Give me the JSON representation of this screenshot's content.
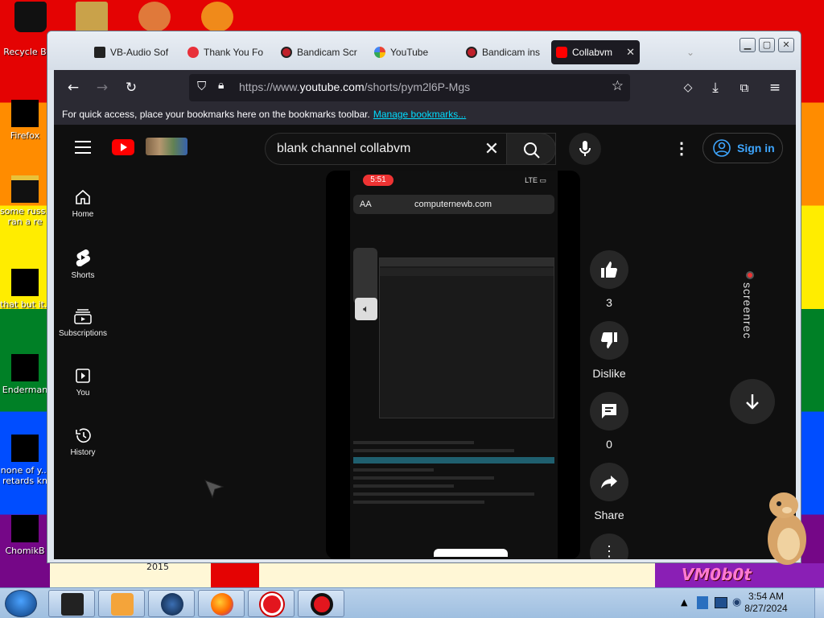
{
  "desktop": {
    "icons": [
      {
        "label": "Recycle Bin",
        "label_shown": "Recycle B"
      },
      {
        "label": "Firefox"
      },
      {
        "label": "some russ...",
        "label_line2": "ran a re"
      },
      {
        "label": "that but it..."
      },
      {
        "label": "Enderman"
      },
      {
        "label": "none of y...",
        "label_line2": "retards kn"
      },
      {
        "label": "ChomikB"
      }
    ],
    "wallpaper_year": "2015",
    "wallpaper_watermark": "VM0b0t"
  },
  "browser": {
    "tabs": [
      {
        "title": "VB-Audio Sof",
        "favicon_color": "#222222"
      },
      {
        "title": "Thank You Fo",
        "favicon_color": "#e8303a"
      },
      {
        "title": "Bandicam Scr",
        "favicon_color": "#c0202a"
      },
      {
        "title": "YouTube",
        "favicon_color": "#4285f4"
      },
      {
        "title": "Bandicam ins",
        "favicon_color": "#c0202a"
      },
      {
        "title": "Collabvm",
        "favicon_color": "#ff0000",
        "active": true
      }
    ],
    "url_prefix": "https://www.",
    "url_host": "youtube.com",
    "url_path": "/shorts/pym2l6P-Mgs",
    "bookmark_hint": "For quick access, place your bookmarks here on the bookmarks toolbar.",
    "bookmark_link": "Manage bookmarks..."
  },
  "youtube": {
    "search_value": "blank channel collabvm",
    "sign_in": "Sign in",
    "nav": [
      {
        "label": "Home",
        "icon": "home-icon"
      },
      {
        "label": "Shorts",
        "icon": "shorts-icon"
      },
      {
        "label": "Subscriptions",
        "icon": "subscriptions-icon"
      },
      {
        "label": "You",
        "icon": "you-icon"
      },
      {
        "label": "History",
        "icon": "history-icon"
      }
    ],
    "video": {
      "status_time": "5:51",
      "status_network": "LTE",
      "browser_aa": "AA",
      "browser_domain": "computernewb.com"
    },
    "actions": {
      "likes": "3",
      "dislike": "Dislike",
      "comments": "0",
      "share": "Share"
    },
    "overlay_label": "screenrec"
  },
  "taskbar": {
    "time": "3:54 AM",
    "date": "8/27/2024"
  },
  "colors": {
    "yt_red": "#ff0000",
    "link_blue": "#3ea6ff",
    "bookmark_link": "#00ddff",
    "page_bg": "#0f0f0f"
  }
}
